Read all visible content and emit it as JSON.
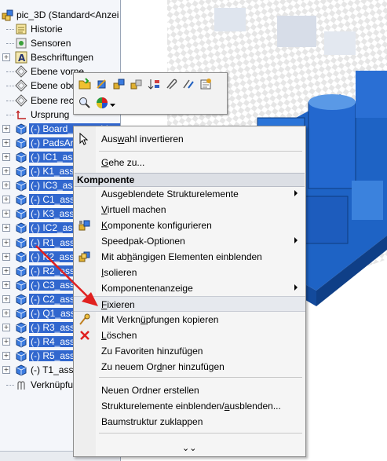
{
  "tree": {
    "root": "pic_3D  (Standard<Anzei",
    "items": [
      {
        "label": "Historie",
        "icon": "history-icon",
        "expander": "",
        "sel": false
      },
      {
        "label": "Sensoren",
        "icon": "sensor-icon",
        "expander": "",
        "sel": false
      },
      {
        "label": "Beschriftungen",
        "icon": "annotation-icon",
        "expander": "+",
        "sel": false
      },
      {
        "label": "Ebene vorne",
        "icon": "plane-icon",
        "expander": "",
        "sel": false
      },
      {
        "label": "Ebene obe",
        "icon": "plane-icon",
        "expander": "",
        "sel": false
      },
      {
        "label": "Ebene rech",
        "icon": "plane-icon",
        "expander": "",
        "sel": false
      },
      {
        "label": "Ursprung",
        "icon": "origin-icon",
        "expander": "",
        "sel": false
      },
      {
        "label": "(-) Board_assembly<",
        "icon": "component-icon",
        "expander": "+",
        "sel": true
      },
      {
        "label": "(-) PadsAr",
        "icon": "component-icon",
        "expander": "+",
        "sel": true
      },
      {
        "label": "(-) IC1_ass",
        "icon": "component-icon",
        "expander": "+",
        "sel": true
      },
      {
        "label": "(-) K1_ass",
        "icon": "component-icon",
        "expander": "+",
        "sel": true
      },
      {
        "label": "(-) IC3_ass",
        "icon": "component-icon",
        "expander": "+",
        "sel": true
      },
      {
        "label": "(-) C1_ass",
        "icon": "component-icon",
        "expander": "+",
        "sel": true
      },
      {
        "label": "(-) K3_ass",
        "icon": "component-icon",
        "expander": "+",
        "sel": true
      },
      {
        "label": "(-) IC2_ass",
        "icon": "component-icon",
        "expander": "+",
        "sel": true
      },
      {
        "label": "(-) R1_ass",
        "icon": "component-icon",
        "expander": "+",
        "sel": true
      },
      {
        "label": "(-) K2_ass",
        "icon": "component-icon",
        "expander": "+",
        "sel": true
      },
      {
        "label": "(-) R2_ass",
        "icon": "component-icon",
        "expander": "+",
        "sel": true
      },
      {
        "label": "(-) C3_ass",
        "icon": "component-icon",
        "expander": "+",
        "sel": true
      },
      {
        "label": "(-) C2_ass",
        "icon": "component-icon",
        "expander": "+",
        "sel": true
      },
      {
        "label": "(-) Q1_ass",
        "icon": "component-icon",
        "expander": "+",
        "sel": true
      },
      {
        "label": "(-) R3_ass",
        "icon": "component-icon",
        "expander": "+",
        "sel": true
      },
      {
        "label": "(-) R4_ass",
        "icon": "component-icon",
        "expander": "+",
        "sel": true
      },
      {
        "label": "(-) R5_ass",
        "icon": "component-icon",
        "expander": "+",
        "sel": true
      },
      {
        "label": "(-) T1_ass",
        "icon": "component-icon",
        "expander": "+",
        "sel": false
      },
      {
        "label": "Verknüpfu",
        "icon": "mates-icon",
        "expander": "",
        "sel": false
      }
    ]
  },
  "menu": {
    "items": [
      {
        "pre": "Aus",
        "u": "w",
        "post": "ahl invertieren"
      },
      {
        "pre": "",
        "u": "G",
        "post": "ehe zu..."
      }
    ],
    "header": "Komponente",
    "component_items": [
      {
        "pre": "Ausgeblendete Strukturelemente",
        "u": "",
        "post": "",
        "sub": true
      },
      {
        "pre": "",
        "u": "V",
        "post": "irtuell machen"
      },
      {
        "pre": "",
        "u": "K",
        "post": "omponente konfigurieren"
      },
      {
        "pre": "Speedpak-Optionen",
        "u": "",
        "post": "",
        "sub": true
      },
      {
        "pre": "Mit ab",
        "u": "h",
        "post": "ängigen Elementen einblenden"
      },
      {
        "pre": "",
        "u": "I",
        "post": "solieren"
      },
      {
        "pre": "Komponentenanzeige",
        "u": "",
        "post": "",
        "sub": true
      },
      {
        "pre": "",
        "u": "F",
        "post": "ixieren",
        "hl": true
      },
      {
        "pre": "Mit Verkn",
        "u": "ü",
        "post": "pfungen kopieren"
      },
      {
        "pre": "",
        "u": "L",
        "post": "öschen"
      },
      {
        "pre": "Zu Favoriten hinzufügen",
        "u": "",
        "post": ""
      },
      {
        "pre": "Zu neuem Or",
        "u": "d",
        "post": "ner hinzufügen"
      }
    ],
    "folder_items": [
      {
        "pre": "Neuen Ordner erstellen",
        "u": "",
        "post": ""
      },
      {
        "pre": "Strukturelemente einblenden/",
        "u": "a",
        "post": "usblenden..."
      },
      {
        "pre": "Baumstruktur zuklappen",
        "u": "",
        "post": ""
      }
    ],
    "more": "⌄⌄"
  },
  "colors": {
    "selection": "#3167ce",
    "model": "#1f5fbf",
    "arrow": "#e02020"
  }
}
